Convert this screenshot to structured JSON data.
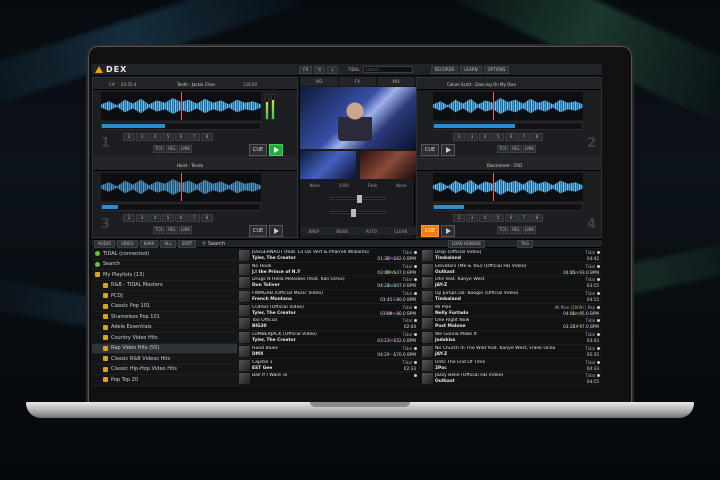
{
  "app": {
    "name": "DEX",
    "top_fx": "FX",
    "top_cd": "II",
    "top_mic": "↓",
    "search_label": "TIDAL",
    "search_ph": "search",
    "btn_records": "RECORDS",
    "btn_learn": "LEARN",
    "btn_options": "OPTIONS"
  },
  "decks": [
    {
      "num": "1",
      "title": "Teeth - Jackie Chan",
      "key": "C#",
      "time": "03:55.4",
      "bpm": "126.00",
      "cue": "CUE",
      "extras": [
        "TCX",
        "REL",
        "LINK"
      ],
      "bars": [
        "2",
        "3",
        "4",
        "5",
        "6",
        "7",
        "8"
      ]
    },
    {
      "num": "2",
      "title": "Calum Scott - Dancing On My Own",
      "key": "",
      "time": "",
      "bpm": "",
      "cue": "CUE",
      "extras": [
        "TCX",
        "REL",
        "LINK"
      ],
      "bars": [
        "2",
        "3",
        "4",
        "5",
        "6",
        "7",
        "8"
      ]
    },
    {
      "num": "3",
      "title": "Hoist - Tenda",
      "key": "",
      "time": "",
      "bpm": "",
      "cue": "CUE",
      "extras": [
        "TCX",
        "REL",
        "LINK"
      ],
      "bars": [
        "2",
        "3",
        "4",
        "5",
        "6",
        "7",
        "8"
      ]
    },
    {
      "num": "4",
      "title": "Blackstreet - CRD",
      "key": "",
      "time": "",
      "bpm": "",
      "cue": "CUE",
      "extras": [
        "TCX",
        "REL",
        "LINK"
      ],
      "bars": [
        "2",
        "3",
        "4",
        "5",
        "6",
        "7",
        "8"
      ]
    }
  ],
  "center": {
    "tabs": [
      "VID",
      "FX",
      "MIX"
    ],
    "labels": [
      "None",
      "1000",
      "Fade",
      "None"
    ],
    "mix_buttons": [
      "BRKP",
      "NEWS",
      "AUTO",
      "CLEAN"
    ]
  },
  "toolbar": {
    "items": [
      "AUDIO",
      "VIDEO",
      "KARA",
      "ALL",
      "SORT"
    ],
    "search": "Search",
    "right": [
      "LOAD KONOSE",
      "TAG"
    ]
  },
  "library": {
    "items": [
      {
        "label": "TIDAL (connected)",
        "icon": "tidal-icon",
        "sel": false
      },
      {
        "label": "Search",
        "icon": "search-icon",
        "sel": false
      },
      {
        "label": "My Playlists (13)",
        "icon": "folder-icon",
        "sel": false
      },
      {
        "label": "R&B - TIDAL Masters",
        "icon": "playlist-icon",
        "sel": false
      },
      {
        "label": "PCDJ",
        "icon": "playlist-icon",
        "sel": false
      },
      {
        "label": "Classic Pop 101",
        "icon": "playlist-icon",
        "sel": false
      },
      {
        "label": "Shameless Pop 101",
        "icon": "playlist-icon",
        "sel": false
      },
      {
        "label": "Adele Essentials",
        "icon": "playlist-icon",
        "sel": false
      },
      {
        "label": "Country Video Hits",
        "icon": "playlist-icon",
        "sel": false
      },
      {
        "label": "Rap Video Hits (50)",
        "icon": "playlist-icon",
        "sel": true
      },
      {
        "label": "Classic R&B Videos Hits",
        "icon": "playlist-icon",
        "sel": false
      },
      {
        "label": "Classic Hip-Hop Video Hits",
        "icon": "playlist-icon",
        "sel": false
      },
      {
        "label": "Pop Top 20",
        "icon": "playlist-icon",
        "sel": false
      }
    ]
  },
  "tracks_left": [
    {
      "title": "JUGGERNAUT (feat. Lil Uzi Vert & Pharrell Williams)",
      "artist": "Tyler, The Creator",
      "key": "C#m",
      "bpm": "01:36 - 162.0 BPM",
      "src": "Tidal",
      "kc": "#d84fc4"
    },
    {
      "title": "No Hook",
      "artist": "J.I the Prince of N.Y",
      "key": "F#m",
      "bpm": "03:00 - 147.0 BPM",
      "src": "Tidal",
      "kc": "#c8d14a"
    },
    {
      "title": "Drugs N Hella Melodies (feat. Kali Uchis)",
      "artist": "Don Toliver",
      "key": "Ebm",
      "bpm": "04:23 - 107.0 BPM",
      "src": "Tidal",
      "kc": "#3ec7b6"
    },
    {
      "title": "FWMGAB (Official Music Video)",
      "artist": "French Montana",
      "key": "G",
      "bpm": "03:45 - 80.0 BPM",
      "src": "Tidal",
      "kc": "#7a7aee"
    },
    {
      "title": "CORSO (Official Video)",
      "artist": "Tyler, The Creator",
      "key": "F#m",
      "bpm": "03:09 - 80.0 BPM",
      "src": "Tidal",
      "kc": "#d84fc4"
    },
    {
      "title": "Too Official",
      "artist": "BIG30",
      "key": "",
      "bpm": "02:44",
      "src": "Tidal",
      "kc": "#ccc"
    },
    {
      "title": "LUMBERJACK (Official Video)",
      "artist": "Tyler, The Creator",
      "key": "Am",
      "bpm": "03:23 - 152.0 BPM",
      "src": "Tidal",
      "kc": "#d84fc4"
    },
    {
      "title": "Hood Blues",
      "artist": "DMX",
      "key": "A",
      "bpm": "04:29 - 170.0 BPM",
      "src": "Tidal",
      "kc": "#e56a3a"
    },
    {
      "title": "Capitol 1",
      "artist": "EST Gee",
      "key": "",
      "bpm": "02:33",
      "src": "Tidal",
      "kc": "#ccc"
    },
    {
      "title": "Ball If I Want To",
      "artist": "",
      "key": "",
      "bpm": "",
      "src": "",
      "kc": "#ccc"
    }
  ],
  "tracks_right": [
    {
      "title": "Drop (Official Video)",
      "artist": "Timbaland",
      "key": "",
      "bpm": "04:42",
      "src": "Tidal",
      "kc": "#ccc"
    },
    {
      "title": "Elevators (Me & You) (Official HD Video)",
      "artist": "Outkast",
      "key": "Abm",
      "bpm": "04:15 - 93.0 BPM",
      "src": "Tidal",
      "kc": "#6cc040"
    },
    {
      "title": "Otis feat. Kanye West",
      "artist": "JAY-Z",
      "key": "",
      "bpm": "03:15",
      "src": "Tidal",
      "kc": "#ccc"
    },
    {
      "title": "Up Jumps Da' Boogie (Official Video)",
      "artist": "Timbaland",
      "key": "",
      "bpm": "04:15",
      "src": "Tidal",
      "kc": "#ccc"
    },
    {
      "title": "Mi Plan",
      "artist": "Nelly Furtado",
      "key": "Am",
      "bpm": "04:01 - 95.0 BPM",
      "src": "Mi Plan (2009) | Pop",
      "kc": "#e8c21a"
    },
    {
      "title": "One Right Now",
      "artist": "Post Malone",
      "key": "C#",
      "bpm": "03:20 - 97.0 BPM",
      "src": "Tidal",
      "kc": "#e8c21a"
    },
    {
      "title": "We Gonna Make It",
      "artist": "Jadakiss",
      "key": "",
      "bpm": "03:43",
      "src": "Tidal",
      "kc": "#ccc"
    },
    {
      "title": "No Church In The Wild feat. Kanye West, Frank Ocean &",
      "artist": "JAY-Z",
      "key": "",
      "bpm": "05:35",
      "src": "Tidal",
      "kc": "#ccc"
    },
    {
      "title": "Until The End Of Time",
      "artist": "2Pac",
      "key": "",
      "bpm": "04:33",
      "src": "Tidal",
      "kc": "#ccc"
    },
    {
      "title": "Jazzy Belle (Official HD Video)",
      "artist": "Outkast",
      "key": "",
      "bpm": "04:15",
      "src": "Tidal",
      "kc": "#ccc"
    }
  ]
}
